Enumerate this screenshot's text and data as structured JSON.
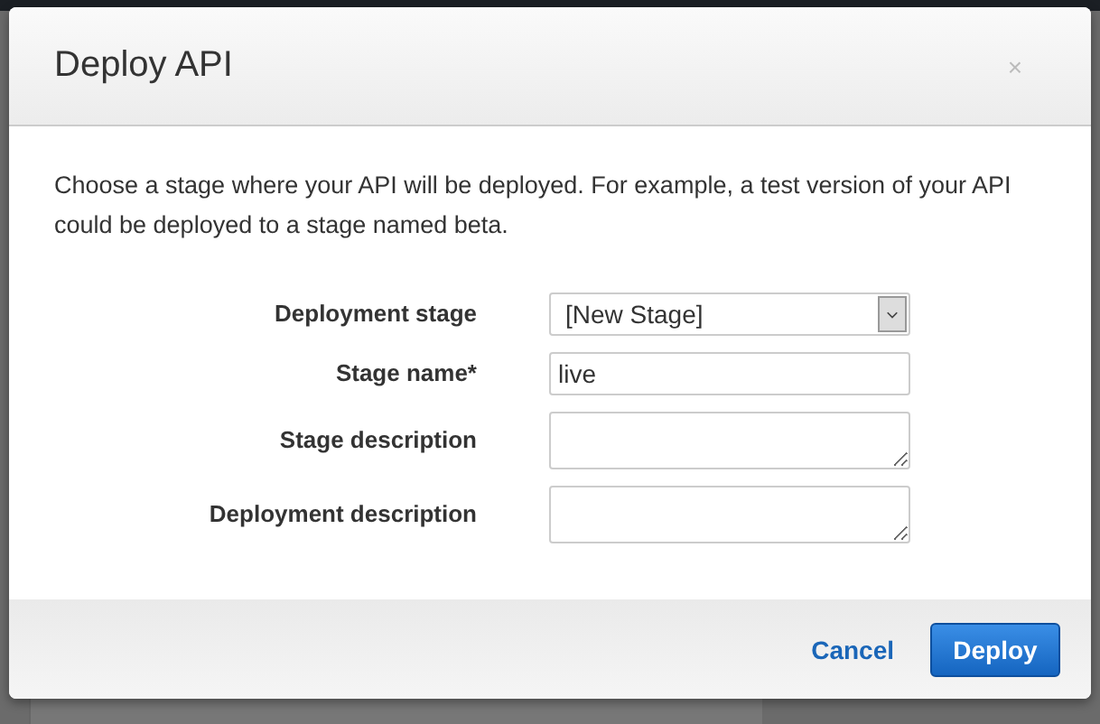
{
  "dialog": {
    "title": "Deploy API",
    "close": "×",
    "description": "Choose a stage where your API will be deployed. For example, a test version of your API could be deployed to a stage named beta.",
    "fields": [
      {
        "kind": "select",
        "label": "Deployment stage",
        "value": "[New Stage]"
      },
      {
        "kind": "text",
        "label": "Stage name*",
        "value": "live"
      },
      {
        "kind": "textarea",
        "label": "Stage description"
      },
      {
        "kind": "textarea",
        "label": "Deployment description"
      }
    ],
    "buttons": [
      {
        "kind": "link",
        "label": "Cancel"
      },
      {
        "kind": "primary",
        "label": "Deploy"
      }
    ]
  }
}
